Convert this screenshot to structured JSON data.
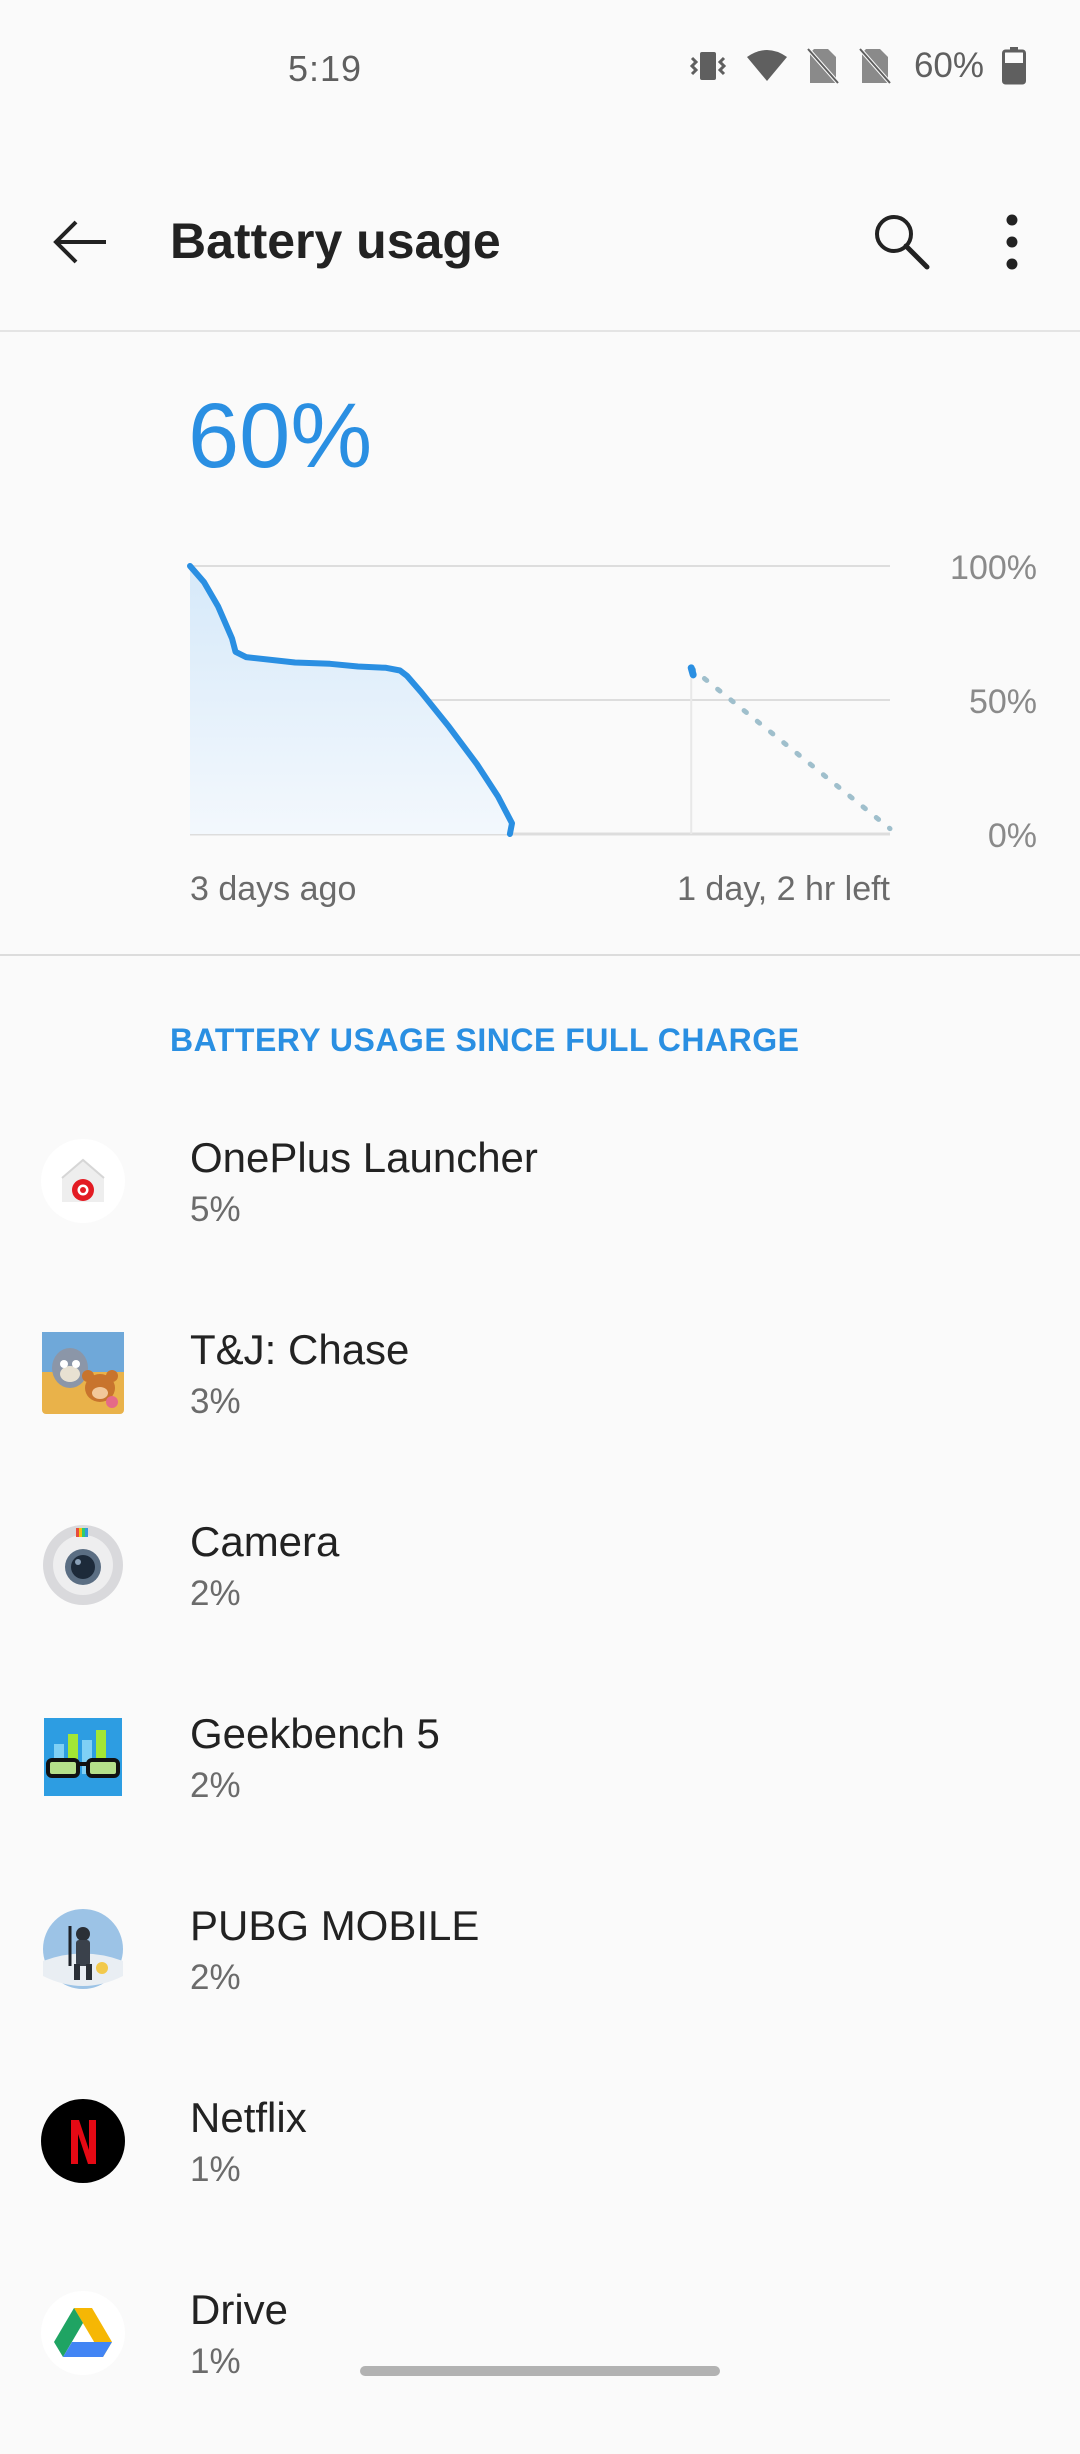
{
  "status_bar": {
    "time": "5:19",
    "battery_percent": "60%",
    "icons": [
      "vibrate-icon",
      "wifi-icon",
      "no-sim-icon",
      "no-sim-icon",
      "battery-icon"
    ]
  },
  "header": {
    "title": "Battery usage",
    "back_icon": "arrow-left-icon",
    "search_icon": "search-icon",
    "more_icon": "more-vert-icon"
  },
  "battery": {
    "level": "60%"
  },
  "chart_data": {
    "type": "line",
    "y_tick_labels": [
      "100%",
      "50%",
      "0%"
    ],
    "ylim": [
      0,
      100
    ],
    "x_start_label": "3 days ago",
    "x_end_label": "1 day, 2 hr left",
    "series": [
      {
        "style": "solid",
        "color": "#2a8fe2",
        "points": [
          [
            0.0,
            100
          ],
          [
            0.02,
            94
          ],
          [
            0.04,
            85
          ],
          [
            0.06,
            73
          ],
          [
            0.065,
            68
          ],
          [
            0.08,
            66
          ],
          [
            0.15,
            64
          ],
          [
            0.2,
            63.5
          ],
          [
            0.24,
            62.5
          ],
          [
            0.28,
            62
          ],
          [
            0.3,
            61
          ],
          [
            0.31,
            59
          ],
          [
            0.33,
            53
          ],
          [
            0.37,
            40
          ],
          [
            0.41,
            26
          ],
          [
            0.44,
            14
          ],
          [
            0.46,
            4
          ],
          [
            0.457,
            0
          ]
        ]
      },
      {
        "style": "dotted",
        "color": "#9fbfcc",
        "points": [
          [
            0.716,
            62
          ],
          [
            1.0,
            2
          ]
        ]
      }
    ],
    "grid": true,
    "colors": {
      "line": "#2a8fe2",
      "fill_top": "#d6e9f9",
      "fill_bottom": "#f3f8fd",
      "projection": "#9fbfcc",
      "grid": "#dddddd"
    }
  },
  "section": {
    "title": "BATTERY USAGE SINCE FULL CHARGE"
  },
  "apps": [
    {
      "name": "OnePlus Launcher",
      "usage": "5%",
      "icon": "oneplus-launcher-icon"
    },
    {
      "name": "T&J: Chase",
      "usage": "3%",
      "icon": "tom-and-jerry-chase-icon"
    },
    {
      "name": "Camera",
      "usage": "2%",
      "icon": "camera-icon"
    },
    {
      "name": "Geekbench 5",
      "usage": "2%",
      "icon": "geekbench-icon"
    },
    {
      "name": "PUBG MOBILE",
      "usage": "2%",
      "icon": "pubg-mobile-icon"
    },
    {
      "name": "Netflix",
      "usage": "1%",
      "icon": "netflix-icon"
    },
    {
      "name": "Drive",
      "usage": "1%",
      "icon": "google-drive-icon"
    }
  ]
}
